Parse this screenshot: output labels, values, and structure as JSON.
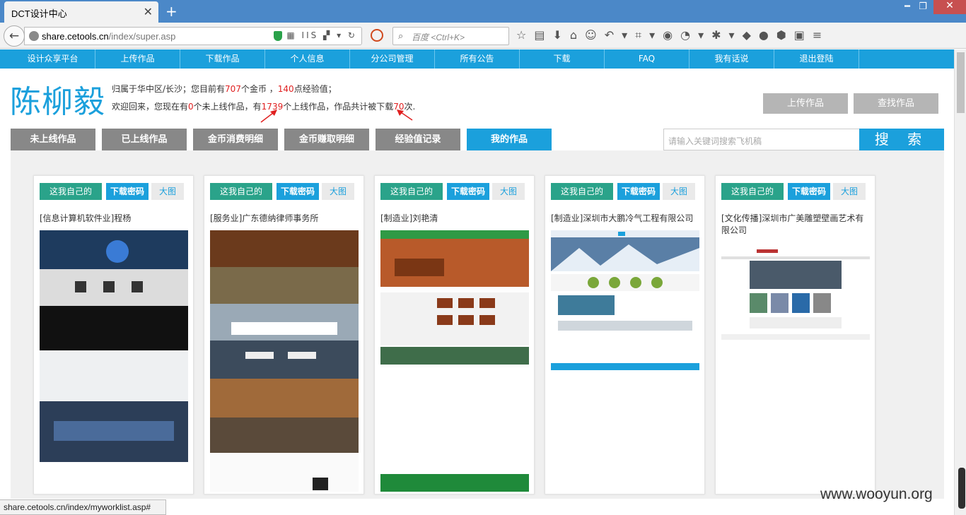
{
  "browser": {
    "tab_title": "DCT设计中心",
    "url_domain": "share.cetools.cn",
    "url_path": "/index/super.asp",
    "search_placeholder": "百度 <Ctrl+K>",
    "status_url": "share.cetools.cn/index/myworklist.asp#"
  },
  "nav": {
    "items": [
      "设计众享平台",
      "上传作品",
      "下载作品",
      "个人信息",
      "分公司管理",
      "所有公告",
      "下载",
      "FAQ",
      "我有话说",
      "退出登陆"
    ]
  },
  "profile": {
    "name": "陈柳毅",
    "line1_a": "归属于华中区/长沙；您目前有",
    "coins": "707",
    "line1_b": "个金币 ，",
    "exp": "140",
    "line1_c": "点经验值；",
    "line2_a": "欢迎回来，您现在有",
    "not_online": "0",
    "line2_b": "个未上线作品，有",
    "online": "1739",
    "line2_c": "个上线作品，作品共计被下载",
    "downloads": "70",
    "line2_d": "次."
  },
  "actions": {
    "upload": "上传作品",
    "find": "查找作品"
  },
  "tabs": [
    "未上线作品",
    "已上线作品",
    "金币消费明细",
    "金币赚取明细",
    "经验值记录",
    "我的作品"
  ],
  "active_tab": 5,
  "search": {
    "placeholder": "请输入关键词搜索飞机稿",
    "button": "搜 索"
  },
  "card_buttons": {
    "own": "这我自己的",
    "download": "下载密码",
    "big": "大图"
  },
  "cards": [
    {
      "title": "[信息计算机软件业]程杨"
    },
    {
      "title": "[服务业]广东德纳律师事务所"
    },
    {
      "title": "[制造业]刘艳清"
    },
    {
      "title": "[制造业]深圳市大鹏冷气工程有限公司"
    },
    {
      "title": "[文化传播]深圳市广美雕塑壁画艺术有限公司"
    }
  ],
  "watermark": "www.wooyun.org",
  "colors": {
    "accent": "#1ba0dc",
    "green": "#2aa38a",
    "tab_gray": "#888888",
    "red": "#e02020"
  }
}
